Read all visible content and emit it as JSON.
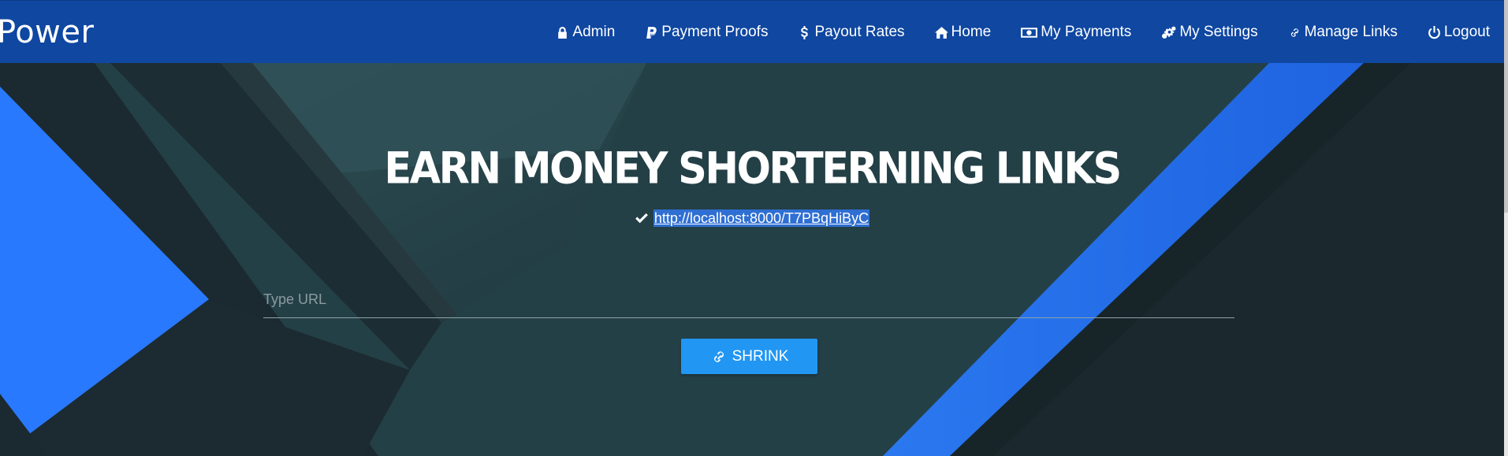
{
  "brand": "Power",
  "nav": [
    {
      "label": "Admin",
      "icon": "lock-icon"
    },
    {
      "label": "Payment Proofs",
      "icon": "paypal-icon"
    },
    {
      "label": "Payout Rates",
      "icon": "dollar-icon"
    },
    {
      "label": "Home",
      "icon": "home-icon"
    },
    {
      "label": "My Payments",
      "icon": "money-icon"
    },
    {
      "label": "My Settings",
      "icon": "gears-icon"
    },
    {
      "label": "Manage Links",
      "icon": "link-icon"
    },
    {
      "label": "Logout",
      "icon": "power-icon"
    }
  ],
  "hero": {
    "title": "EARN MONEY SHORTERNING LINKS",
    "short_link": "http://localhost:8000/T7PBqHiByC",
    "input_placeholder": "Type URL",
    "input_value": "",
    "button_label": "SHRINK"
  },
  "colors": {
    "navbar": "#0f47a1",
    "accent_blue": "#2979ff",
    "button": "#2196f3",
    "dark_teal": "#244047"
  }
}
